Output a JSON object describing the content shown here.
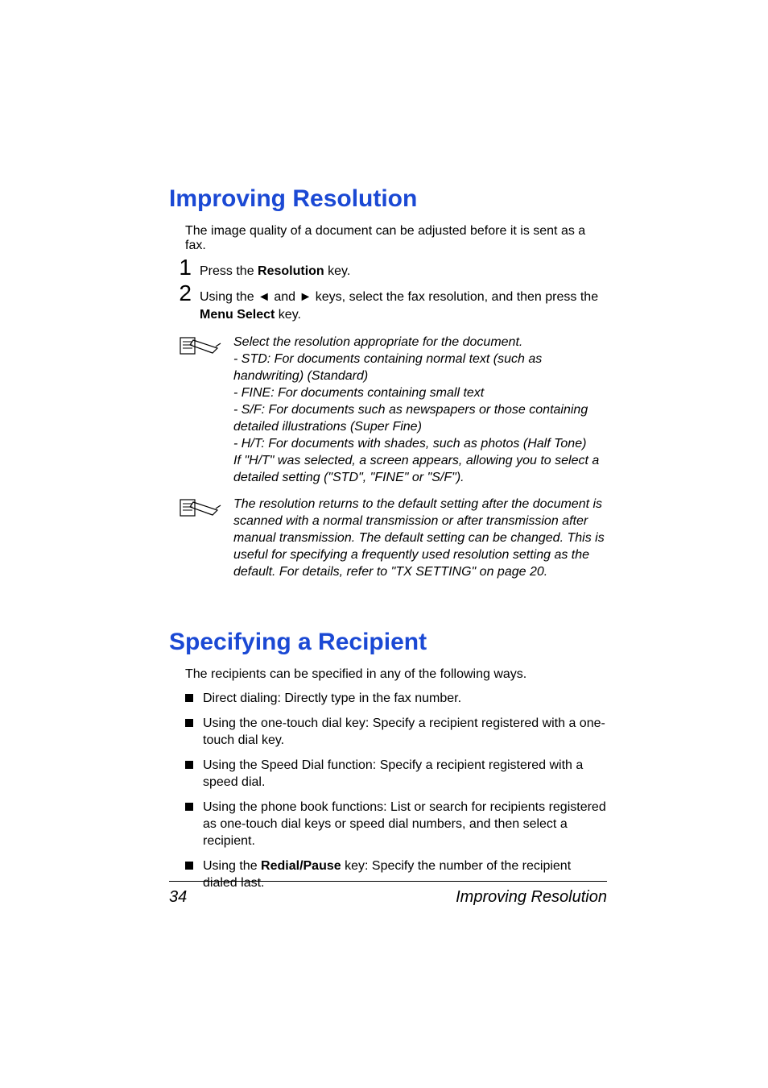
{
  "h1a": "Improving Resolution",
  "introA": "The image quality of a document can be adjusted before it is sent as a fax.",
  "step1_pre": "Press the ",
  "step1_key": "Resolution",
  "step1_post": " key.",
  "step2_pre": "Using the ",
  "step2_arrowL": "◄",
  "step2_mid1": " and ",
  "step2_arrowR": "►",
  "step2_mid2": " keys, select the fax resolution, and then press the ",
  "step2_key": "Menu Select",
  "step2_post": " key.",
  "note1_l1": "Select the resolution appropriate for the document.",
  "note1_l2": "- STD: For documents containing normal text (such as handwriting) (Standard)",
  "note1_l3": "- FINE: For documents containing small text",
  "note1_l4": "- S/F: For documents such as newspapers or those containing detailed illustrations (Super Fine)",
  "note1_l5": "- H/T: For documents with shades, such as photos (Half Tone)",
  "note1_l6": "If \"H/T\" was selected, a screen appears, allowing you to select a detailed setting (\"STD\", \"FINE\" or \"S/F\").",
  "note2": "The resolution returns to the default setting after the document is scanned with a normal transmission or after transmission after manual transmission. The default setting can be changed. This is useful for specifying a frequently used resolution setting as the default. For details, refer to \"TX SETTING\" on page 20.",
  "h1b": "Specifying a Recipient",
  "introB": "The recipients can be specified in any of the following ways.",
  "b1": "Direct dialing: Directly type in the fax number.",
  "b2": "Using the one-touch dial key: Specify a recipient registered with a one-touch dial key.",
  "b3": "Using the Speed Dial function: Specify a recipient registered with a speed dial.",
  "b4": "Using the phone book functions: List or search for recipients registered as one-touch dial keys or speed dial numbers, and then select a recipient.",
  "b5_pre": "Using the ",
  "b5_key": "Redial/Pause",
  "b5_post": " key: Specify the number of the recipient dialed last.",
  "pageNum": "34",
  "footerTitle": "Improving Resolution"
}
